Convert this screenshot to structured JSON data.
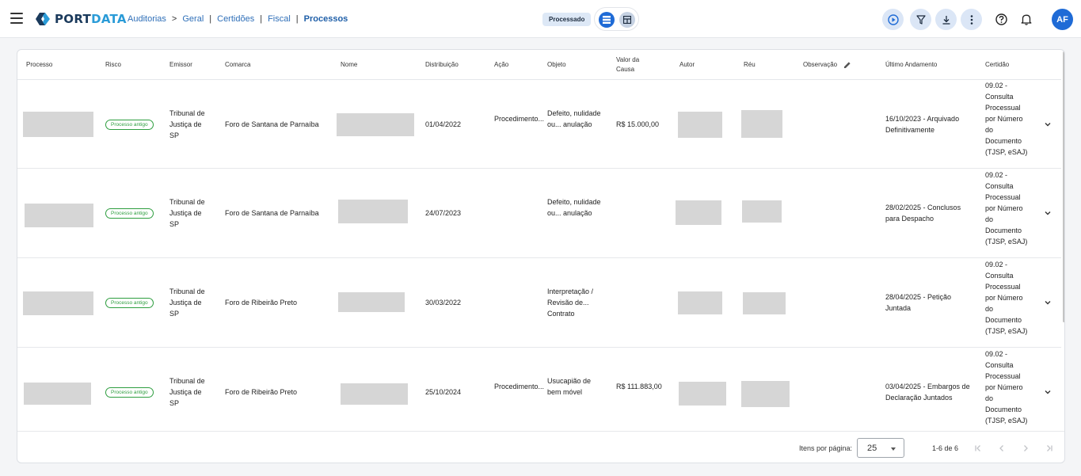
{
  "app": {
    "logo_part1": "PORT",
    "logo_part2": "DATA",
    "brand_colors": {
      "dark": "#1b3a5c",
      "light": "#2a9bd7"
    }
  },
  "breadcrumb": {
    "items": [
      "Auditorias",
      "Geral",
      "Certidões",
      "Fiscal",
      "Processos"
    ],
    "separators": [
      ">",
      "|",
      "|",
      "|"
    ]
  },
  "header": {
    "status_chip": "Processado",
    "user_initials": "AF",
    "icons": [
      "menu-icon",
      "list-view-icon",
      "grid-view-icon",
      "play-icon",
      "filter-icon",
      "download-icon",
      "more-vert-icon",
      "help-icon",
      "bell-icon"
    ]
  },
  "table": {
    "columns": [
      "Processo",
      "Risco",
      "Emissor",
      "Comarca",
      "Nome",
      "Distribuição",
      "Ação",
      "Objeto",
      "Valor da Causa",
      "Autor",
      "Réu",
      "Observação",
      "Último Andamento",
      "Certidão"
    ],
    "rows": [
      {
        "risco": "Processo antigo",
        "emissor": "Tribunal de Justiça de SP",
        "comarca": "Foro de Santana de Parnaíba",
        "distribuicao": "01/04/2022",
        "acao": "Procedimento...",
        "objeto": "Defeito, nulidade ou... anulação",
        "valor": "R$ 15.000,00",
        "ultimo_andamento": "16/10/2023 - Arquivado Definitivamente",
        "certidao": "09.02 - Consulta Processual por Número do Documento (TJSP, eSAJ)"
      },
      {
        "risco": "Processo antigo",
        "emissor": "Tribunal de Justiça de SP",
        "comarca": "Foro de Santana de Parnaíba",
        "distribuicao": "24/07/2023",
        "acao": "",
        "objeto": "Defeito, nulidade ou... anulação",
        "valor": "",
        "ultimo_andamento": "28/02/2025 - Conclusos para Despacho",
        "certidao": "09.02 - Consulta Processual por Número do Documento (TJSP, eSAJ)"
      },
      {
        "risco": "Processo antigo",
        "emissor": "Tribunal de Justiça de SP",
        "comarca": "Foro de Ribeirão Preto",
        "distribuicao": "30/03/2022",
        "acao": "",
        "objeto": "Interpretação / Revisão de... Contrato",
        "valor": "",
        "ultimo_andamento": "28/04/2025 - Petição Juntada",
        "certidao": "09.02 - Consulta Processual por Número do Documento (TJSP, eSAJ)"
      },
      {
        "risco": "Processo antigo",
        "emissor": "Tribunal de Justiça de SP",
        "comarca": "Foro de Ribeirão Preto",
        "distribuicao": "25/10/2024",
        "acao": "Procedimento...",
        "objeto": "Usucapião de bem móvel",
        "valor": "R$ 111.883,00",
        "ultimo_andamento": "03/04/2025 - Embargos de Declaração Juntados",
        "certidao": "09.02 - Consulta Processual por Número do Documento (TJSP, eSAJ)"
      }
    ]
  },
  "pagination": {
    "items_per_page_label": "Itens por página:",
    "items_per_page": "25",
    "range": "1-6 de 6"
  }
}
